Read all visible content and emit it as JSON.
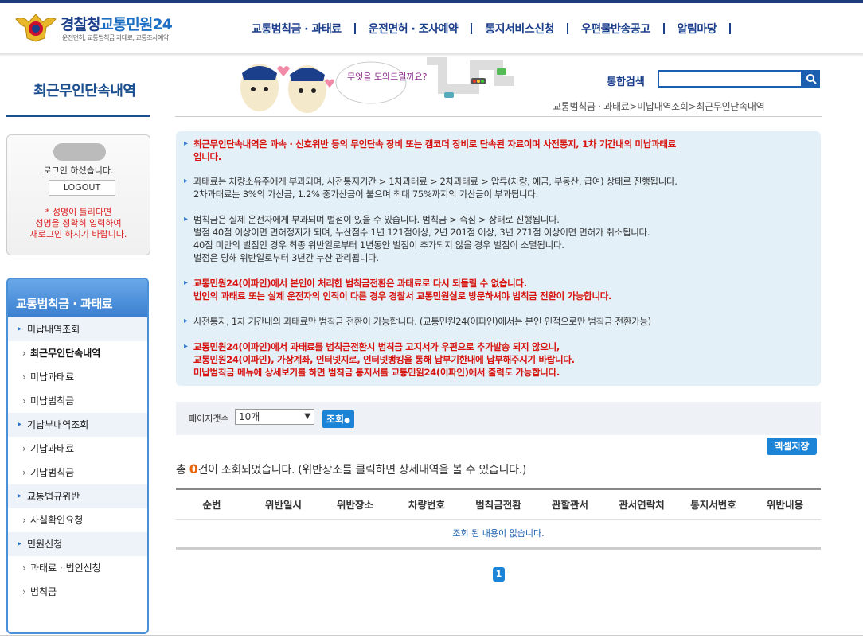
{
  "header": {
    "logo_title_1": "경찰청",
    "logo_title_2": "교통민원24",
    "logo_subtitle": "운전면허, 교통범칙금 과태료, 교통조사예약",
    "nav": [
      "교통범칙금 · 과태료",
      "운전면허 · 조사예약",
      "통지서비스신청",
      "우편물반송공고",
      "알림마당"
    ]
  },
  "page": {
    "title": "최근무인단속내역",
    "search_label": "통합검색",
    "search_value": "",
    "breadcrumb": "교통범칙금 · 과태료>미납내역조회>최근무인단속내역",
    "illustration_text": "무엇을 도와드릴까요?"
  },
  "login": {
    "status": "로그인 하셨습니다.",
    "logout": "LOGOUT",
    "warning": "* 성명이 틀리다면\n성명을 정확히 입력하여\n재로그인 하시기 바랍니다."
  },
  "lnb": {
    "title": "교통범칙금 · 과태료",
    "items": [
      {
        "label": "미납내역조회",
        "level": 1
      },
      {
        "label": "최근무인단속내역",
        "level": 2,
        "active": true
      },
      {
        "label": "미납과태료",
        "level": 2
      },
      {
        "label": "미납범칙금",
        "level": 2
      },
      {
        "label": "기납부내역조회",
        "level": 1
      },
      {
        "label": "기납과태료",
        "level": 2
      },
      {
        "label": "기납범칙금",
        "level": 2
      },
      {
        "label": "교통법규위반",
        "level": 1
      },
      {
        "label": "사실확인요청",
        "level": 2
      },
      {
        "label": "민원신청",
        "level": 1
      },
      {
        "label": "과태료 · 법인신청",
        "level": 2
      },
      {
        "label": "범칙금",
        "level": 2
      }
    ]
  },
  "notice": [
    {
      "style": "red",
      "text": "최근무인단속내역은 과속 · 신호위반 등의 무인단속 장비 또는 캠코더 장비로 단속된 자료이며 사전통지, 1차 기간내의 미납과태료\n 입니다."
    },
    {
      "style": "dark",
      "text": "과태료는 차량소유주에게 부과되며, 사전통지기간 > 1차과태료 > 2차과태료 > 압류(차량, 예금, 부동산, 급여) 상태로 진행됩니다.\n 2차과태료는 3%의 가산금, 1.2% 중가산금이 붙으며 최대 75%까지의 가산금이 부과됩니다."
    },
    {
      "style": "dark",
      "text": "범칙금은 실제 운전자에게 부과되며 벌점이 있을 수 있습니다. 범칙금 > 즉심 > 상태로 진행됩니다.\n 벌점 40점 이상이면 면허정지가 되며, 누산점수 1년 121점이상, 2년 201점 이상, 3년 271점 이상이면 면허가 취소됩니다.\n 40점 미만의 벌점인 경우 최종 위반일로부터 1년동안 벌점이 추가되지 않을 경우 벌점이 소멸됩니다.\n 벌점은 당해 위반일로부터 3년간 누산 관리됩니다."
    },
    {
      "style": "red",
      "text": "교통민원24(이파인)에서 본인이 처리한 범칙금전환은 과태료로 다시 되돌릴 수 없습니다.\n 법인의 과태료 또는 실제 운전자의 인적이 다른 경우 경찰서 교통민원실로 방문하셔야 범칙금 전환이 가능합니다."
    },
    {
      "style": "dark",
      "text": "사전통지, 1차 기간내의 과태료만 범칙금 전환이 가능합니다. (교통민원24(이파인)에서는 본인 인적으로만 범칙금 전환가능)"
    },
    {
      "style": "red",
      "text": "교통민원24(이파인)에서 과태료를 범칙금전환시 범칙금 고지서가 우편으로 추가발송 되지 않으니,\n 교통민원24(이파인), 가상계좌, 인터넷지로, 인터넷뱅킹을 통해 납부기한내에 납부해주시기 바랍니다.\n 미납범칙금 메뉴에 상세보기를 하면 범칙금 통지서를 교통민원24(이파인)에서 출력도 가능합니다."
    }
  ],
  "controls": {
    "page_size_label": "페이지갯수",
    "page_size_value": "10개",
    "query_button": "조회",
    "excel_button": "엑셀저장"
  },
  "result": {
    "prefix": "총 ",
    "count": "0",
    "suffix": "건이 조회되었습니다. (위반장소를 클릭하면 상세내역을 볼 수 있습니다.)"
  },
  "table": {
    "columns": [
      "순번",
      "위반일시",
      "위반장소",
      "차량번호",
      "범칙금전환",
      "관할관서",
      "관서연락처",
      "통지서번호",
      "위반내용"
    ],
    "empty_message": "조회 된 내용이 없습니다."
  },
  "pagination": {
    "current": "1"
  },
  "colors": {
    "brand": "#1b3f8b",
    "accent": "#1b84d6",
    "warning": "#d8140f",
    "count": "#e8660c"
  }
}
